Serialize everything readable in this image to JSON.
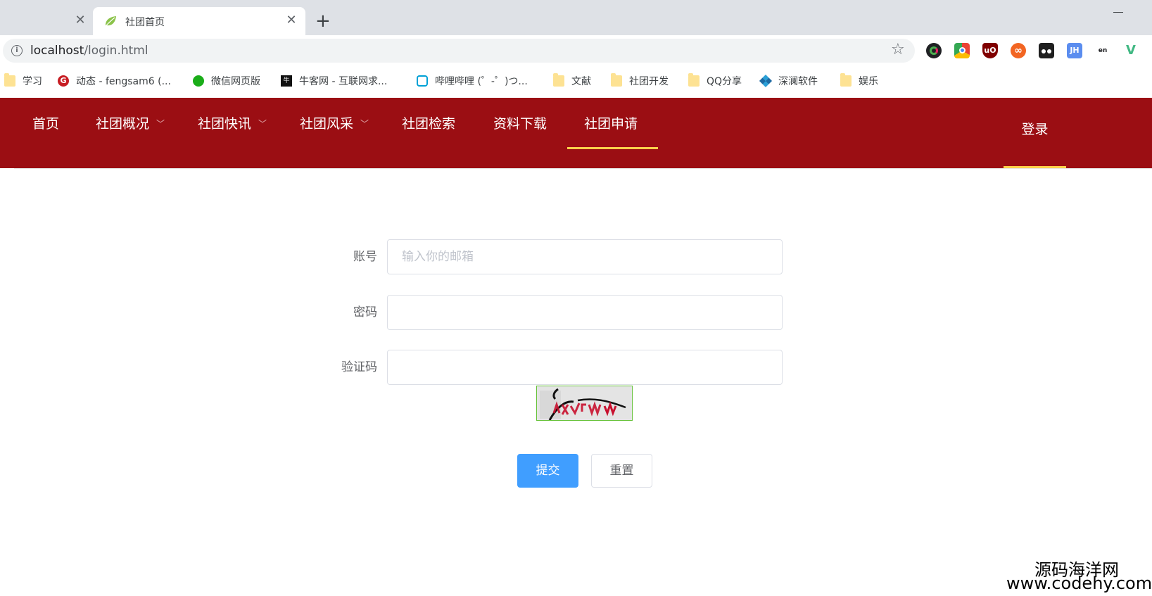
{
  "browser": {
    "tabs": [
      {
        "title": "",
        "close": "✕"
      },
      {
        "title": "社团首页",
        "close": "✕"
      }
    ],
    "new_tab": "+",
    "url_host": "localhost",
    "url_path": "/login.html",
    "info_glyph": "i",
    "star_glyph": "☆",
    "extensions": [
      {
        "name": "color-picker-icon",
        "label": "",
        "color": "#202124"
      },
      {
        "name": "chrome-store-icon",
        "label": "",
        "color": "#4285f4"
      },
      {
        "name": "ublock-icon",
        "label": "uO",
        "color": "#800000"
      },
      {
        "name": "infinity-icon",
        "label": "∞",
        "color": "#f26522"
      },
      {
        "name": "tampermonkey-icon",
        "label": "",
        "color": "#1f1f1f"
      },
      {
        "name": "jh-icon",
        "label": "JH",
        "color": "#5b8def"
      },
      {
        "name": "translate-icon",
        "label": "en",
        "color": "#ffffff"
      },
      {
        "name": "vue-devtools-icon",
        "label": "V",
        "color": "#41b883"
      }
    ],
    "bookmarks": [
      {
        "label": "学习",
        "icon": "folder-icon"
      },
      {
        "label": "动态 - fengsam6 (...",
        "icon": "gitee-icon"
      },
      {
        "label": "微信网页版",
        "icon": "wechat-icon"
      },
      {
        "label": "牛客网 - 互联网求...",
        "icon": "nowcoder-icon"
      },
      {
        "label": "哔哩哔哩 (゜-゜)つ...",
        "icon": "bilibili-icon"
      },
      {
        "label": "文献",
        "icon": "folder-icon"
      },
      {
        "label": "社团开发",
        "icon": "folder-icon"
      },
      {
        "label": "QQ分享",
        "icon": "folder-icon"
      },
      {
        "label": "深澜软件",
        "icon": "srun-icon"
      },
      {
        "label": "娱乐",
        "icon": "folder-icon"
      }
    ]
  },
  "nav": {
    "items": [
      {
        "label": "首页",
        "dropdown": false
      },
      {
        "label": "社团概况",
        "dropdown": true
      },
      {
        "label": "社团快讯",
        "dropdown": true
      },
      {
        "label": "社团风采",
        "dropdown": true
      },
      {
        "label": "社团检索",
        "dropdown": false
      },
      {
        "label": "资料下载",
        "dropdown": false
      },
      {
        "label": "社团申请",
        "dropdown": false,
        "active": true
      }
    ],
    "chevron": "﹀",
    "login": "登录",
    "bg_color": "#9b0e13",
    "active_color": "#ffd04b"
  },
  "form": {
    "account_label": "账号",
    "account_placeholder": "输入你的邮箱",
    "account_value": "",
    "password_label": "密码",
    "password_value": "",
    "captcha_label": "验证码",
    "captcha_value": "",
    "submit": "提交",
    "reset": "重置",
    "submit_color": "#409eff"
  },
  "watermark": {
    "line1": "源码海洋网",
    "line2": "www.codehy.com"
  }
}
